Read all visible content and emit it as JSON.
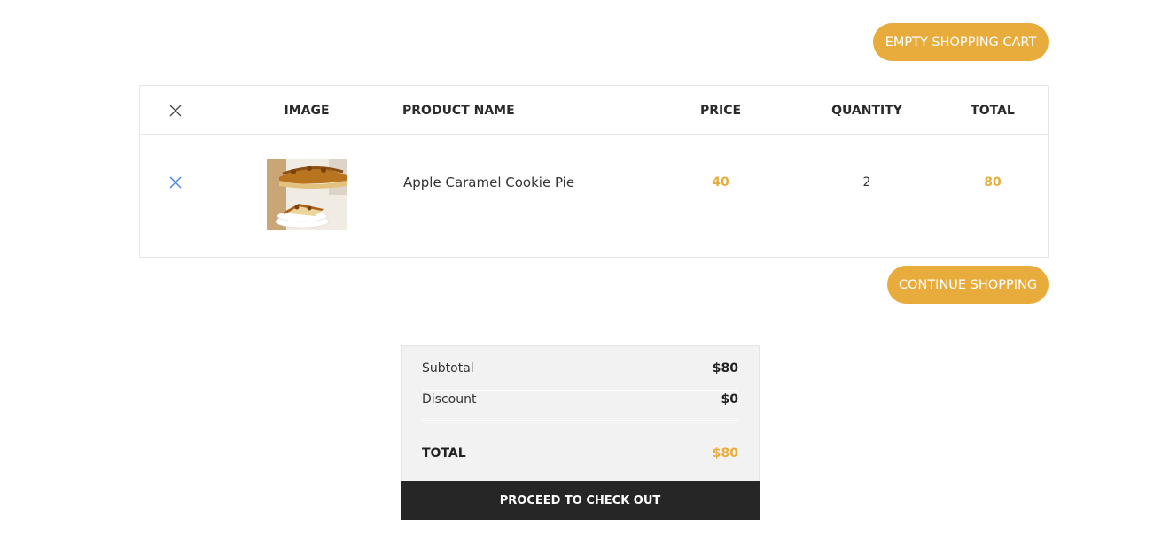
{
  "actions": {
    "empty_cart_label": "EMPTY SHOPPING CART",
    "continue_shopping_label": "CONTINUE SHOPPING"
  },
  "cart": {
    "columns": {
      "remove_icon": "close-icon",
      "image": "IMAGE",
      "product_name": "PRODUCT NAME",
      "price": "PRICE",
      "quantity": "QUANTITY",
      "total": "TOTAL"
    },
    "items": [
      {
        "remove_icon": "close-icon",
        "image_subject": "apple caramel cookie pie slices",
        "name": "Apple Caramel Cookie Pie",
        "price": "40",
        "quantity": "2",
        "total": "80"
      }
    ]
  },
  "summary": {
    "subtotal_label": "Subtotal",
    "subtotal_value": "$80",
    "discount_label": "Discount",
    "discount_value": "$0",
    "total_label": "TOTAL",
    "total_value": "$80"
  },
  "checkout": {
    "label": "PROCEED TO CHECK OUT"
  },
  "colors": {
    "accent": "#e8ac3c",
    "remove_icon_blue": "#3f7fe6",
    "header_icon": "#444444",
    "checkout_bg": "#262626",
    "summary_bg": "#f2f2f2"
  }
}
